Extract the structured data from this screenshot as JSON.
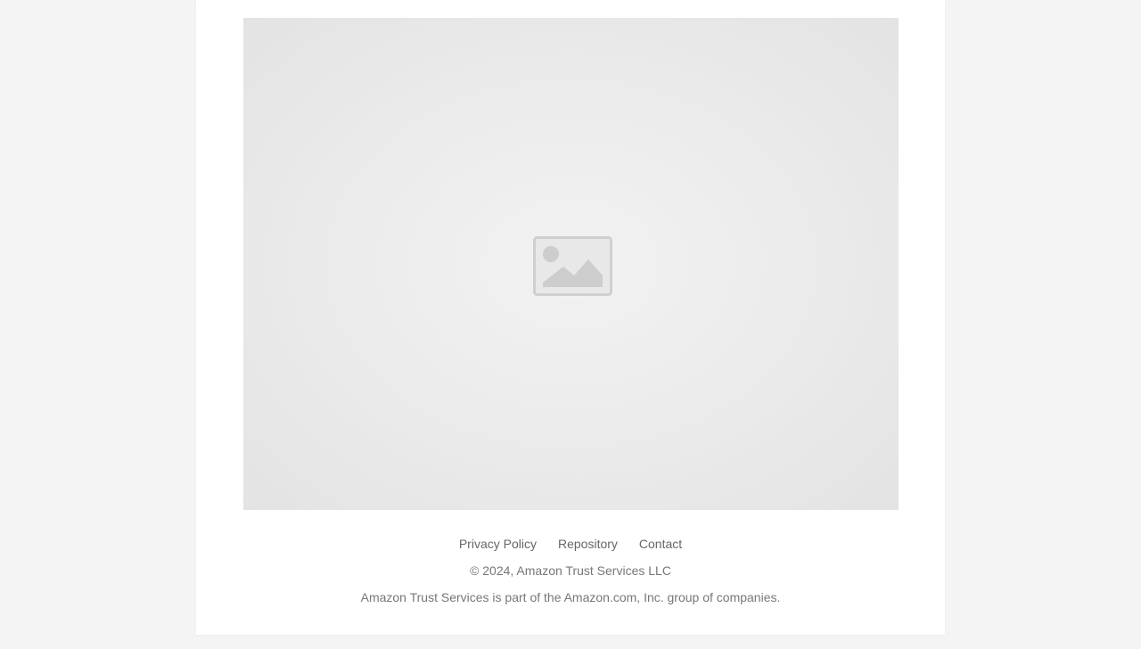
{
  "hero": {
    "icon": "image-placeholder-icon"
  },
  "footer": {
    "links": [
      {
        "label": "Privacy Policy"
      },
      {
        "label": "Repository"
      },
      {
        "label": "Contact"
      }
    ],
    "copyright": "© 2024, Amazon Trust Services LLC",
    "tagline": "Amazon Trust Services is part of the Amazon.com, Inc. group of companies."
  },
  "colors": {
    "background": "#f4f4f4",
    "card": "#ffffff",
    "link": "#666666",
    "text": "#777777"
  }
}
